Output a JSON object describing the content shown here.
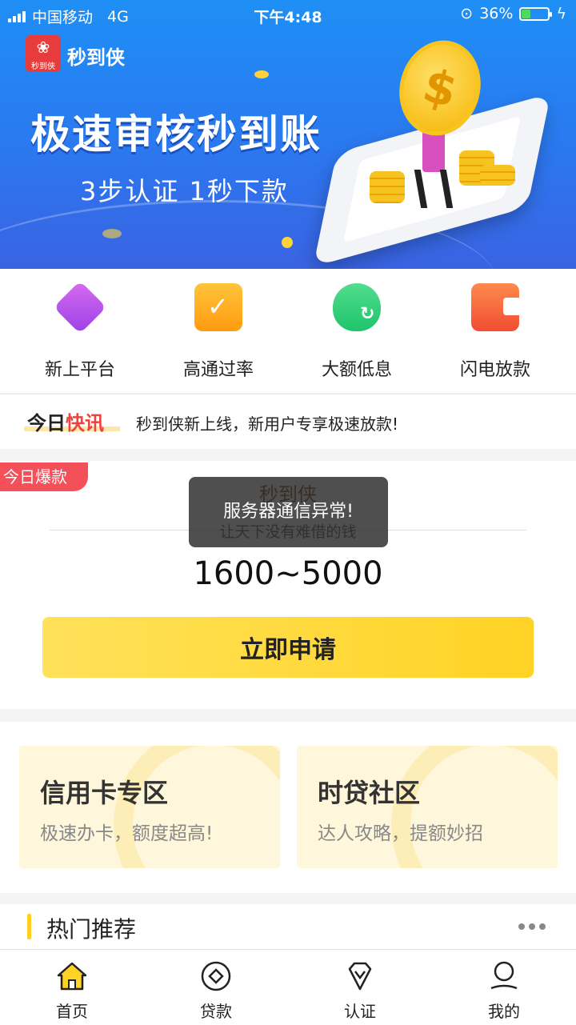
{
  "status_bar": {
    "carrier": "中国移动",
    "network": "4G",
    "time": "下午4:48",
    "battery_percent": "36%",
    "battery_level": 0.36
  },
  "banner": {
    "logo_text": "秒到侠",
    "brand": "秒到侠",
    "headline": "极速审核秒到账",
    "subline": "3步认证  1秒下款"
  },
  "features": [
    {
      "label": "新上平台",
      "icon": "tag-icon",
      "color": "#b04ef0"
    },
    {
      "label": "高通过率",
      "icon": "checklist-icon",
      "color": "#ffab1f"
    },
    {
      "label": "大额低息",
      "icon": "money-bag-icon",
      "color": "#2cd27a"
    },
    {
      "label": "闪电放款",
      "icon": "wallet-icon",
      "color": "#f45a3a"
    }
  ],
  "news": {
    "badge_part1": "今日",
    "badge_part2": "快讯",
    "text": "秒到侠新上线，新用户专享极速放款!"
  },
  "hot_product": {
    "tag": "今日爆款",
    "name": "秒到侠",
    "slogan": "让天下没有难借的钱",
    "amount": "1600~5000",
    "apply_label": "立即申请"
  },
  "toast": "服务器通信异常!",
  "zones": [
    {
      "title": "信用卡专区",
      "subtitle": "极速办卡，额度超高!"
    },
    {
      "title": "时贷社区",
      "subtitle": "达人攻略，提额妙招"
    }
  ],
  "recommend": {
    "title": "热门推荐"
  },
  "tabbar": [
    {
      "label": "首页",
      "icon": "home-icon",
      "active": true
    },
    {
      "label": "贷款",
      "icon": "loan-icon",
      "active": false
    },
    {
      "label": "认证",
      "icon": "verify-icon",
      "active": false
    },
    {
      "label": "我的",
      "icon": "profile-icon",
      "active": false
    }
  ],
  "colors": {
    "accent_yellow": "#ffd325",
    "banner_blue": "#2b78ef",
    "hot_tag_red": "#f4505a"
  }
}
